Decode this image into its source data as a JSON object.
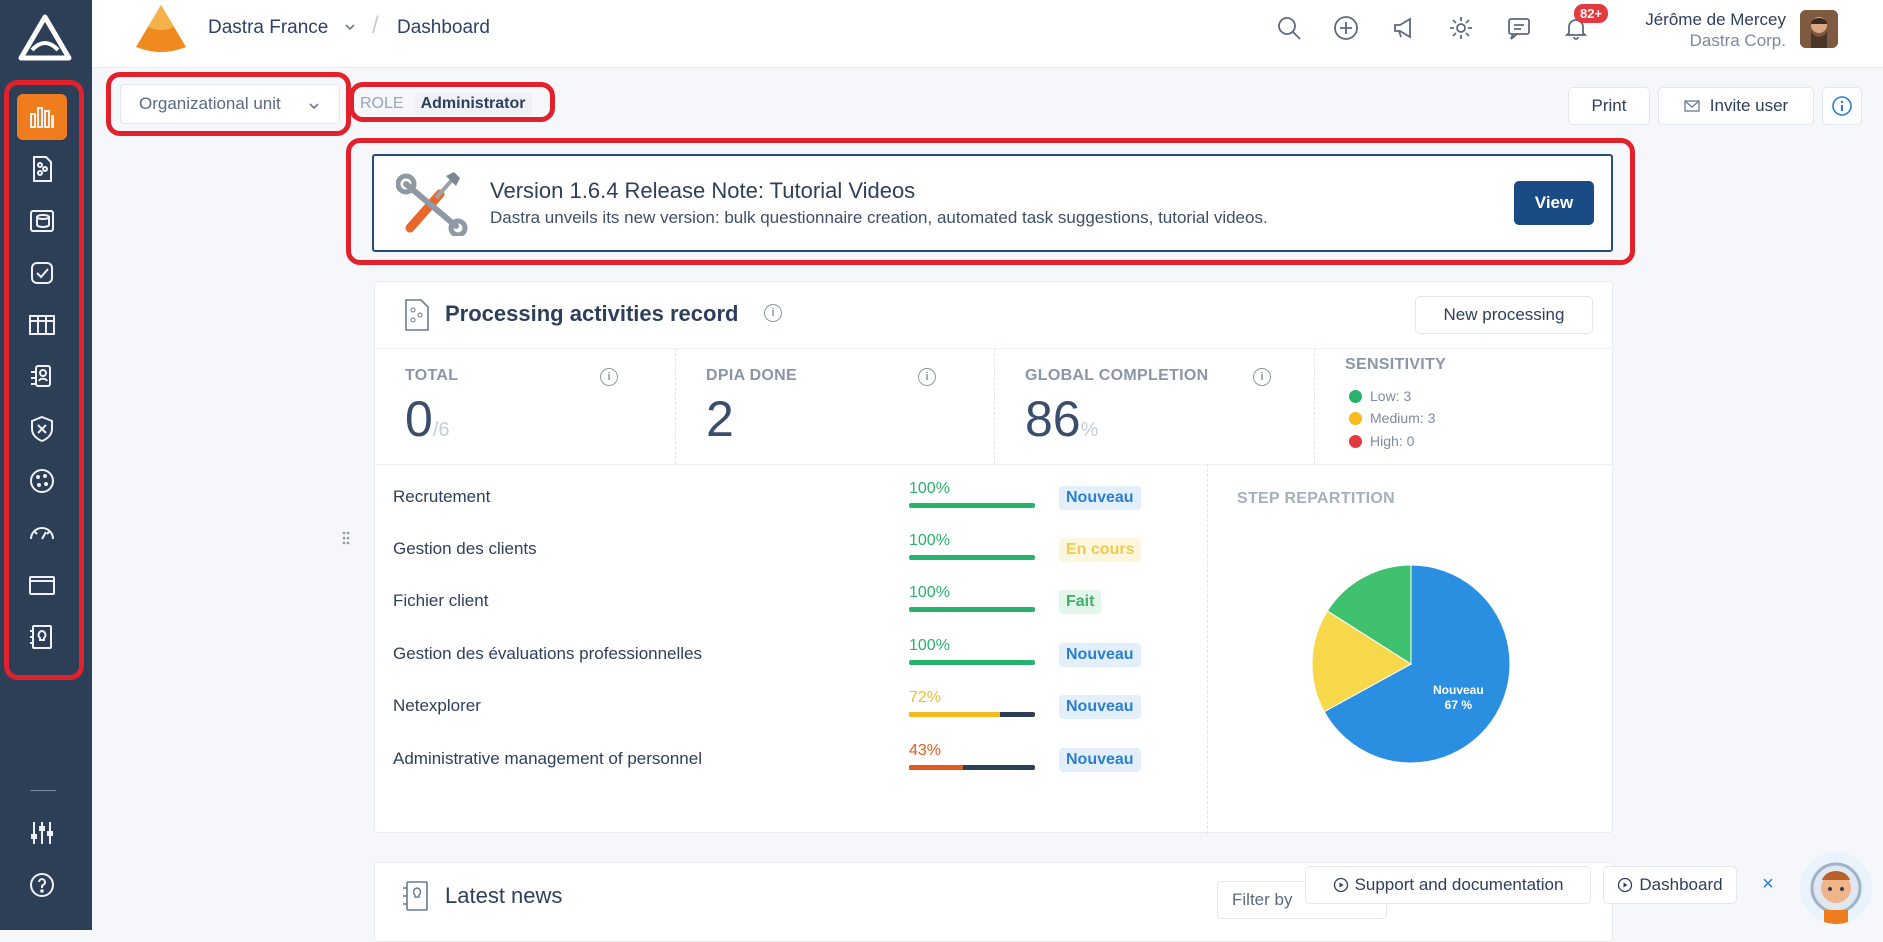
{
  "header": {
    "tenant": "Dastra France",
    "page": "Dashboard",
    "notifications_badge": "82+",
    "user_name": "Jérôme de Mercey",
    "user_org": "Dastra Corp."
  },
  "toolbar": {
    "org_unit_placeholder": "Organizational unit",
    "role_label": "ROLE",
    "role_value": "Administrator",
    "print_label": "Print",
    "invite_label": "Invite user"
  },
  "banner": {
    "title": "Version 1.6.4 Release Note: Tutorial Videos",
    "text": "Dastra unveils its new version: bulk questionnaire creation, automated task suggestions, tutorial videos.",
    "button": "View"
  },
  "processing": {
    "title": "Processing activities record",
    "new_button": "New processing",
    "stats": {
      "total_label": "TOTAL",
      "total_value": "0",
      "total_sub": "/6",
      "dpia_label": "DPIA DONE",
      "dpia_value": "2",
      "completion_label": "GLOBAL COMPLETION",
      "completion_value": "86",
      "completion_sub": "%",
      "sensitivity_label": "SENSITIVITY",
      "sens_low": "Low: 3",
      "sens_medium": "Medium: 3",
      "sens_high": "High: 0"
    },
    "rows": [
      {
        "name": "Recrutement",
        "pct": "100%",
        "status": "Nouveau"
      },
      {
        "name": "Gestion des clients",
        "pct": "100%",
        "status": "En cours"
      },
      {
        "name": "Fichier client",
        "pct": "100%",
        "status": "Fait"
      },
      {
        "name": "Gestion des évaluations professionnelles",
        "pct": "100%",
        "status": "Nouveau"
      },
      {
        "name": "Netexplorer",
        "pct": "72%",
        "status": "Nouveau"
      },
      {
        "name": "Administrative management of personnel",
        "pct": "43%",
        "status": "Nouveau"
      }
    ],
    "step_title": "STEP REPARTITION",
    "pie_label": "Nouveau",
    "pie_pct": "67 %"
  },
  "news": {
    "title": "Latest news",
    "filter_label": "Filter by"
  },
  "help": {
    "support_label": "Support and documentation",
    "dashboard_label": "Dashboard"
  },
  "chart_data": {
    "type": "pie",
    "title": "STEP REPARTITION",
    "categories": [
      "Nouveau",
      "En cours",
      "Fait"
    ],
    "values": [
      67,
      17,
      16
    ],
    "colors": [
      "#2a8fe0",
      "#f7d84a",
      "#3fc06e"
    ]
  },
  "colors": {
    "accent": "#ef7c1d",
    "sidebar": "#2d3e57",
    "primary_button": "#1b4b85",
    "highlight": "#e1222d",
    "progress_green": "#27b36c",
    "progress_yellow": "#f5bb1f",
    "progress_orange": "#e45a1d"
  }
}
